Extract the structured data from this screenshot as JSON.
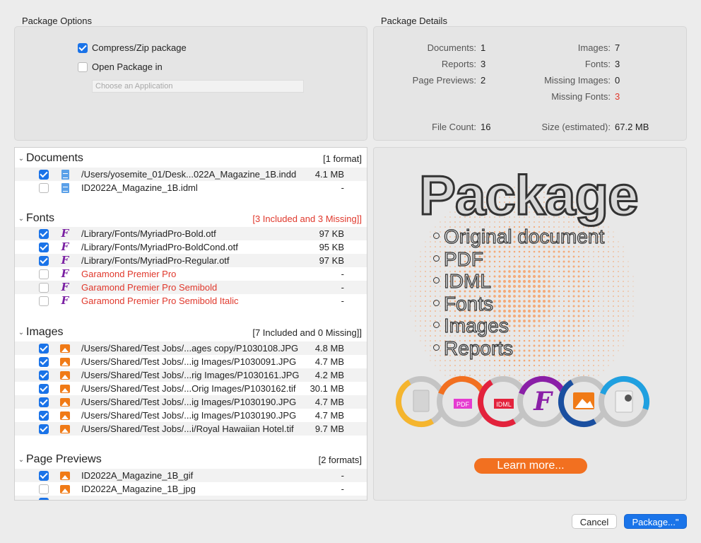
{
  "options": {
    "title": "Package Options",
    "compress_label": "Compress/Zip package",
    "compress_checked": true,
    "open_label": "Open Package in",
    "open_checked": false,
    "app_placeholder": "Choose an Application"
  },
  "details": {
    "title": "Package Details",
    "documents_label": "Documents:",
    "documents_value": "1",
    "reports_label": "Reports:",
    "reports_value": "3",
    "previews_label": "Page Previews:",
    "previews_value": "2",
    "images_label": "Images:",
    "images_value": "7",
    "fonts_label": "Fonts:",
    "fonts_value": "3",
    "missing_images_label": "Missing Images:",
    "missing_images_value": "0",
    "missing_fonts_label": "Missing Fonts:",
    "missing_fonts_value": "3",
    "file_count_label": "File Count:",
    "file_count_value": "16",
    "size_label": "Size (estimated):",
    "size_value": "67.2 MB"
  },
  "groups": {
    "documents": {
      "name": "Documents",
      "summary": "[1 format]",
      "rows": [
        {
          "name": "/Users/yosemite_01/Desk...022A_Magazine_1B.indd",
          "size": "4.1 MB",
          "checked": true
        },
        {
          "name": "ID2022A_Magazine_1B.idml",
          "size": "-",
          "checked": false
        }
      ]
    },
    "fonts": {
      "name": "Fonts",
      "summary": "[3 Included and 3 Missing]]",
      "rows": [
        {
          "name": "/Library/Fonts/MyriadPro-Bold.otf",
          "size": "97 KB",
          "checked": true
        },
        {
          "name": "/Library/Fonts/MyriadPro-BoldCond.otf",
          "size": "95 KB",
          "checked": true
        },
        {
          "name": "/Library/Fonts/MyriadPro-Regular.otf",
          "size": "97 KB",
          "checked": true
        },
        {
          "name": "Garamond Premier Pro",
          "size": "-",
          "checked": false
        },
        {
          "name": "Garamond Premier Pro Semibold",
          "size": "-",
          "checked": false
        },
        {
          "name": "Garamond Premier Pro Semibold Italic",
          "size": "-",
          "checked": false
        }
      ]
    },
    "images": {
      "name": "Images",
      "summary": "[7 Included and 0 Missing]]",
      "rows": [
        {
          "name": "/Users/Shared/Test Jobs/...ages copy/P1030108.JPG",
          "size": "4.8 MB",
          "checked": true
        },
        {
          "name": "/Users/Shared/Test Jobs/...ig Images/P1030091.JPG",
          "size": "4.7 MB",
          "checked": true
        },
        {
          "name": "/Users/Shared/Test Jobs/...rig Images/P1030161.JPG",
          "size": "4.2 MB",
          "checked": true
        },
        {
          "name": "/Users/Shared/Test Jobs/...Orig Images/P1030162.tif",
          "size": "30.1 MB",
          "checked": true
        },
        {
          "name": "/Users/Shared/Test Jobs/...ig Images/P1030190.JPG",
          "size": "4.7 MB",
          "checked": true
        },
        {
          "name": "/Users/Shared/Test Jobs/...ig Images/P1030190.JPG",
          "size": "4.7 MB",
          "checked": true
        },
        {
          "name": "/Users/Shared/Test Jobs/...i/Royal Hawaiian Hotel.tif",
          "size": "9.7 MB",
          "checked": true
        }
      ]
    },
    "previews": {
      "name": "Page Previews",
      "summary": "[2 formats]",
      "rows": [
        {
          "name": "ID2022A_Magazine_1B_gif",
          "size": "-",
          "checked": true
        },
        {
          "name": "ID2022A_Magazine_1B_jpg",
          "size": "-",
          "checked": false
        }
      ]
    }
  },
  "promo": {
    "title": "Package",
    "bullets": [
      "Original document",
      "PDF",
      "IDML",
      "Fonts",
      "Images",
      "Reports"
    ],
    "pdf_tag": "PDF",
    "idml_tag": "IDML",
    "font_glyph": "F",
    "learn_more": "Learn more..."
  },
  "buttons": {
    "cancel": "Cancel",
    "package": "Package...\""
  },
  "colors": {
    "accent": "#1a74e9",
    "missing": "#e0382c",
    "orange": "#f27020",
    "font_purple": "#7a1fa2"
  }
}
